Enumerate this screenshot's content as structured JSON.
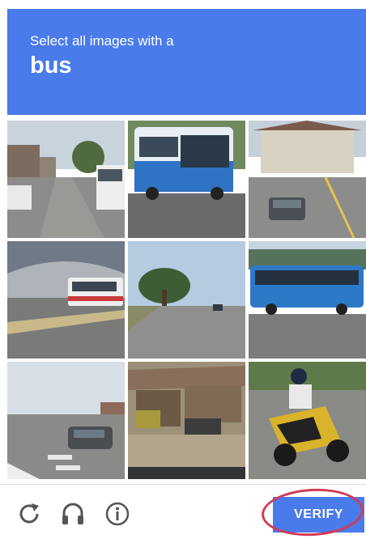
{
  "header": {
    "instruction": "Select all images with a",
    "target": "bus"
  },
  "tiles": [
    {
      "scene": "street-with-bus"
    },
    {
      "scene": "blue-bus-closeup"
    },
    {
      "scene": "intersection-with-car"
    },
    {
      "scene": "stadium-road-bus"
    },
    {
      "scene": "tree-road"
    },
    {
      "scene": "blue-bus-side"
    },
    {
      "scene": "crosswalk-car"
    },
    {
      "scene": "market-stalls"
    },
    {
      "scene": "motorcycle-rider"
    }
  ],
  "footer": {
    "verify_label": "VERIFY",
    "icons": [
      "reload-icon",
      "audio-challenge-icon",
      "info-icon"
    ]
  },
  "colors": {
    "accent": "#4a7bea",
    "highlight": "#d23a55"
  }
}
